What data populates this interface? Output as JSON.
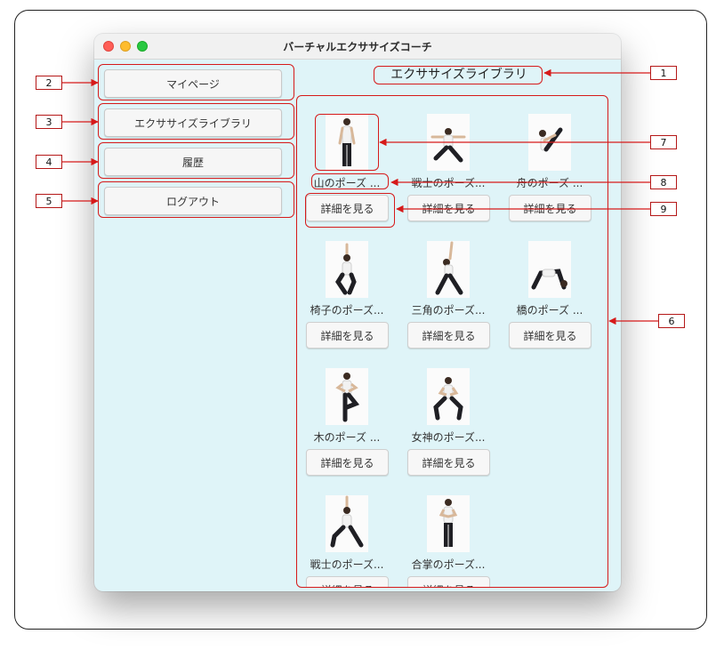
{
  "window": {
    "title": "バーチャルエクササイズコーチ"
  },
  "sidebar": {
    "items": [
      {
        "label": "マイページ"
      },
      {
        "label": "エクササイズライブラリ"
      },
      {
        "label": "履歴"
      },
      {
        "label": "ログアウト"
      }
    ]
  },
  "main": {
    "title": "エクササイズライブラリ",
    "exercises": [
      {
        "name": "山のポーズ ...",
        "button": "詳細を見る"
      },
      {
        "name": "戦士のポーズ...",
        "button": "詳細を見る"
      },
      {
        "name": "舟のポーズ ...",
        "button": "詳細を見る"
      },
      {
        "name": "椅子のポーズ...",
        "button": "詳細を見る"
      },
      {
        "name": "三角のポーズ...",
        "button": "詳細を見る"
      },
      {
        "name": "橋のポーズ ...",
        "button": "詳細を見る"
      },
      {
        "name": "木のポーズ ...",
        "button": "詳細を見る"
      },
      {
        "name": "女神のポーズ...",
        "button": "詳細を見る"
      },
      {
        "name": "戦士のポーズ...",
        "button": "詳細を見る"
      },
      {
        "name": "合掌のポーズ...",
        "button": "詳細を見る"
      }
    ]
  },
  "annotations": {
    "labels": [
      "1",
      "2",
      "3",
      "4",
      "5",
      "6",
      "7",
      "8",
      "9"
    ],
    "color": "#d61a1a"
  }
}
